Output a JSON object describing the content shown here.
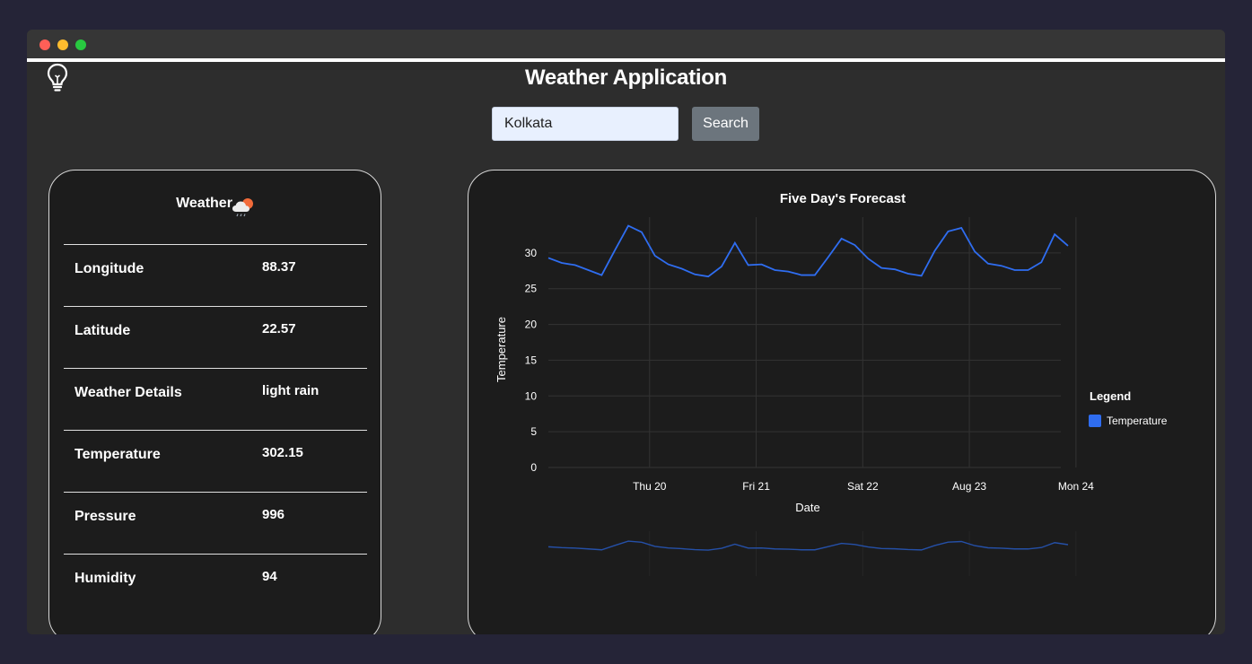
{
  "app": {
    "title": "Weather Application"
  },
  "search": {
    "value": "Kolkata",
    "button_label": "Search"
  },
  "weather_card": {
    "title": "Weather",
    "rows": [
      {
        "label": "Longitude",
        "value": "88.37"
      },
      {
        "label": "Latitude",
        "value": "22.57"
      },
      {
        "label": "Weather Details",
        "value": "light rain"
      },
      {
        "label": "Temperature",
        "value": "302.15"
      },
      {
        "label": "Pressure",
        "value": "996"
      },
      {
        "label": "Humidity",
        "value": "94"
      }
    ]
  },
  "colors": {
    "accent": "#2f6df0",
    "background": "#2d2d2d",
    "card": "#1c1c1c"
  },
  "icons": {
    "theme_toggle": "lightbulb-icon",
    "weather": "cloud-rain-sun-icon"
  },
  "chart_data": {
    "type": "line",
    "title": "Five Day's Forecast",
    "xlabel": "Date",
    "ylabel": "Temperature",
    "ylim": [
      0,
      35
    ],
    "yticks": [
      0,
      5,
      10,
      15,
      20,
      25,
      30
    ],
    "xticks": [
      "Thu 20",
      "Fri 21",
      "Sat 22",
      "Aug 23",
      "Mon 24"
    ],
    "x_tick_index": [
      8,
      16,
      24,
      32,
      40
    ],
    "legend_title": "Legend",
    "legend_position": "right",
    "grid": true,
    "has_range_slider": true,
    "series": [
      {
        "name": "Temperature",
        "color": "#2f6df0",
        "values": [
          29.3,
          28.6,
          28.3,
          27.6,
          26.9,
          30.4,
          33.8,
          32.9,
          29.6,
          28.4,
          27.8,
          27.0,
          26.7,
          28.1,
          31.4,
          28.3,
          28.4,
          27.6,
          27.4,
          26.9,
          26.9,
          29.4,
          32.0,
          31.1,
          29.2,
          27.9,
          27.7,
          27.1,
          26.8,
          30.3,
          33.0,
          33.5,
          30.2,
          28.5,
          28.2,
          27.6,
          27.6,
          28.7,
          32.6,
          31.0
        ]
      }
    ]
  }
}
